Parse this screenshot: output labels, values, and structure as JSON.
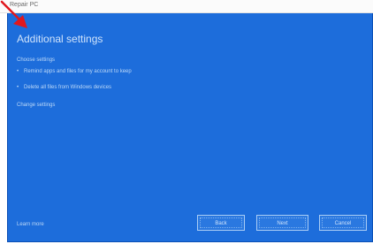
{
  "window": {
    "title": "Repair PC"
  },
  "main": {
    "heading": "Additional settings",
    "section_label": "Choose settings",
    "options": [
      "Remind apps and files for my account to keep",
      "Delete all files from Windows devices"
    ],
    "secondary_label": "Change settings"
  },
  "footer": {
    "link_label": "Learn more",
    "buttons": {
      "back": "Back",
      "next": "Next",
      "cancel": "Cancel"
    }
  },
  "colors": {
    "pane_background": "#1d6ddb",
    "pointer": "#e0181e"
  },
  "icons": {
    "pointer": "red-arrow-pointer-icon"
  }
}
